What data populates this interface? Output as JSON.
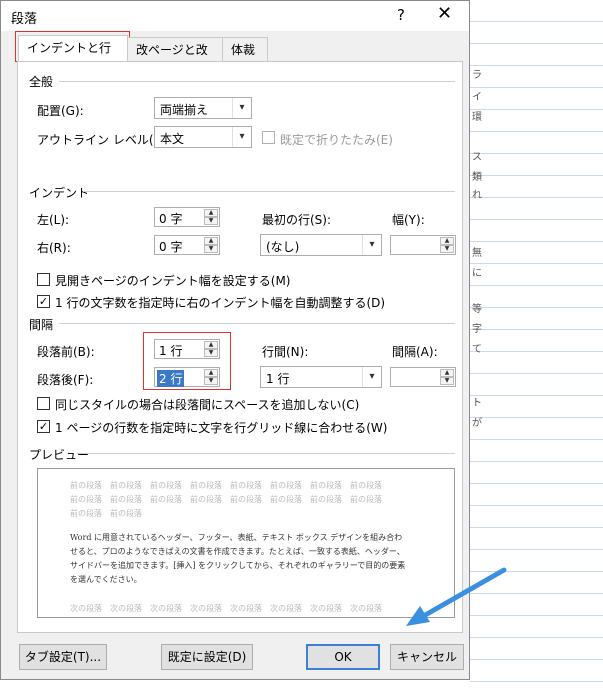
{
  "background_glyphs": [
    "ラ",
    "イ",
    "環",
    "ス",
    "類",
    "れ",
    "無",
    "に",
    "等",
    "字",
    "て",
    "ト",
    "が"
  ],
  "dialog": {
    "title": "段落",
    "help": "?",
    "close": "✕"
  },
  "tabs": [
    {
      "label": "インデントと行間隔"
    },
    {
      "label": "改ページと改行"
    },
    {
      "label": "体裁"
    }
  ],
  "general": {
    "section": "全般",
    "alignment_label": "配置(G):",
    "alignment_value": "両端揃え",
    "outline_label": "アウトライン レベル(O):",
    "outline_value": "本文",
    "collapse_label": "既定で折りたたみ(E)"
  },
  "indent": {
    "section": "インデント",
    "left_label": "左(L):",
    "left_value": "0 字",
    "right_label": "右(R):",
    "right_value": "0 字",
    "special_label": "最初の行(S):",
    "special_value": "(なし)",
    "width_label": "幅(Y):",
    "width_value": "",
    "mirror_label": "見開きページのインデント幅を設定する(M)",
    "auto_adjust_label": "1 行の文字数を指定時に右のインデント幅を自動調整する(D)"
  },
  "spacing": {
    "section": "間隔",
    "before_label": "段落前(B):",
    "before_value": "1 行",
    "after_label": "段落後(F):",
    "after_value": "2 行",
    "line_label": "行間(N):",
    "line_value": "1 行",
    "at_label": "間隔(A):",
    "at_value": "",
    "no_space_label": "同じスタイルの場合は段落間にスペースを追加しない(C)",
    "snap_grid_label": "1 ページの行数を指定時に文字を行グリッド線に合わせる(W)"
  },
  "preview": {
    "section": "プレビュー",
    "prev_lines": [
      "前の段落　前の段落　前の段落　前の段落　前の段落　前の段落　前の段落　前の段落",
      "前の段落　前の段落　前の段落　前の段落　前の段落　前の段落　前の段落　前の段落",
      "前の段落　前の段落"
    ],
    "body_lines": [
      "Word に用意されているヘッダー、フッター、表紙、テキスト ボックス デザインを組み合わ",
      "せると、プロのようなできばえの文書を作成できます。たとえば、一致する表紙、ヘッダー、",
      "サイドバーを追加できます。[挿入] をクリックしてから、それぞれのギャラリーで目的の要素",
      "を選んでください。"
    ],
    "next_lines": [
      "次の段落　次の段落　次の段落　次の段落　次の段落　次の段落　次の段落　次の段落"
    ]
  },
  "buttons": {
    "tabs": "タブ設定(T)...",
    "default": "既定に設定(D)",
    "ok": "OK",
    "cancel": "キャンセル"
  },
  "colors": {
    "highlight_box": "#e03030",
    "arrow": "#3b8fe0",
    "selection": "#3a78c8"
  }
}
